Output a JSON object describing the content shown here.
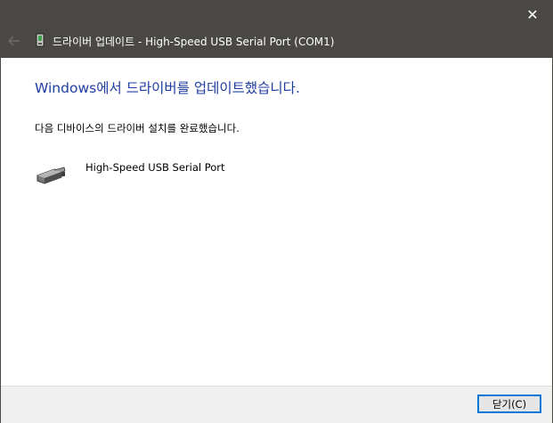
{
  "titlebar": {
    "title": "드라이버 업데이트 - High-Speed USB Serial Port (COM1)",
    "close_symbol": "✕",
    "back_icon": "back-arrow-icon",
    "driver_icon": "driver-update-icon"
  },
  "content": {
    "heading": "Windows에서 드라이버를 업데이트했습니다.",
    "description": "다음 디바이스의 드라이버 설치를 완료했습니다.",
    "device_icon": "usb-serial-connector-icon",
    "device_name": "High-Speed USB Serial Port"
  },
  "footer": {
    "close_label": "닫기(C)"
  },
  "colors": {
    "titlebar_bg": "#4a4845",
    "heading_color": "#1f3ea0",
    "button_border": "#0078d7",
    "footer_bg": "#f0f0f0"
  }
}
